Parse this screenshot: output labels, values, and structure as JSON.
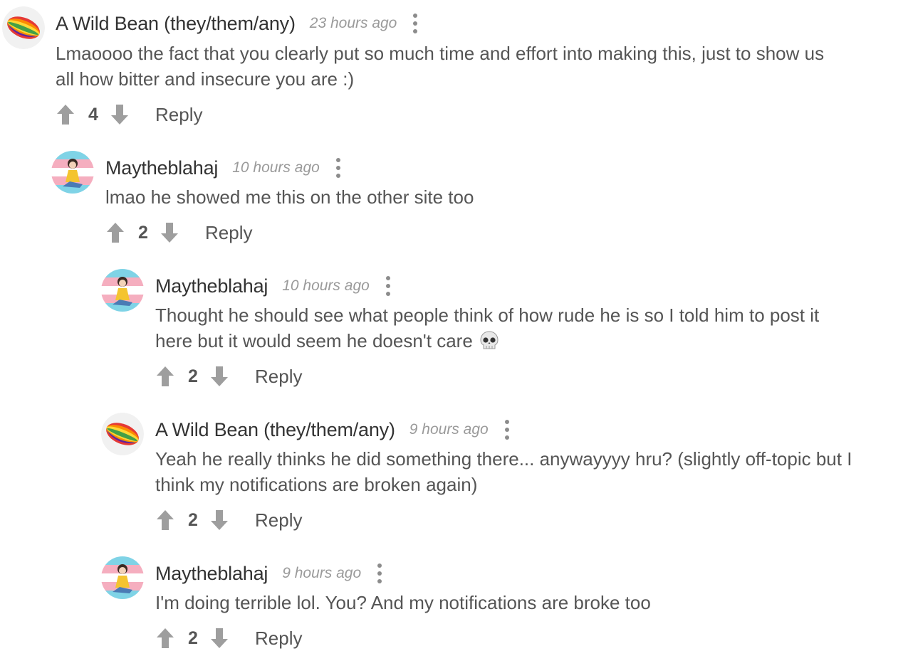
{
  "comments": [
    {
      "author": "A Wild Bean (they/them/any)",
      "time": "23 hours ago",
      "text": "Lmaoooo the fact that you clearly put so much time and effort into making this, just to show us\nall how bitter and insecure you are :)",
      "votes": "4",
      "reply_label": "Reply",
      "avatar_icon": "rainbow-bean-avatar"
    },
    {
      "author": "Maytheblahaj",
      "time": "10 hours ago",
      "text": "lmao he showed me this on the other site too",
      "votes": "2",
      "reply_label": "Reply",
      "avatar_icon": "cartoon-girl-avatar"
    },
    {
      "author": "Maytheblahaj",
      "time": "10 hours ago",
      "text": "Thought he should see what people think of how rude he is so I told him to post it\nhere but it would seem he doesn't care",
      "emoji": "skull-emoji",
      "votes": "2",
      "reply_label": "Reply",
      "avatar_icon": "cartoon-girl-avatar"
    },
    {
      "author": "A Wild Bean (they/them/any)",
      "time": "9 hours ago",
      "text": "Yeah he really thinks he did something there... anywayyyy hru? (slightly off-topic but I\nthink my notifications are broken again)",
      "votes": "2",
      "reply_label": "Reply",
      "avatar_icon": "rainbow-bean-avatar"
    },
    {
      "author": "Maytheblahaj",
      "time": "9 hours ago",
      "text": "I'm doing terrible lol. You? And my notifications are broke too",
      "votes": "2",
      "reply_label": "Reply",
      "avatar_icon": "cartoon-girl-avatar"
    }
  ],
  "colors": {
    "text_primary": "#333333",
    "text_secondary": "#555555",
    "timestamp": "#9a9a9a",
    "vote_arrow": "#9e9e9e"
  }
}
